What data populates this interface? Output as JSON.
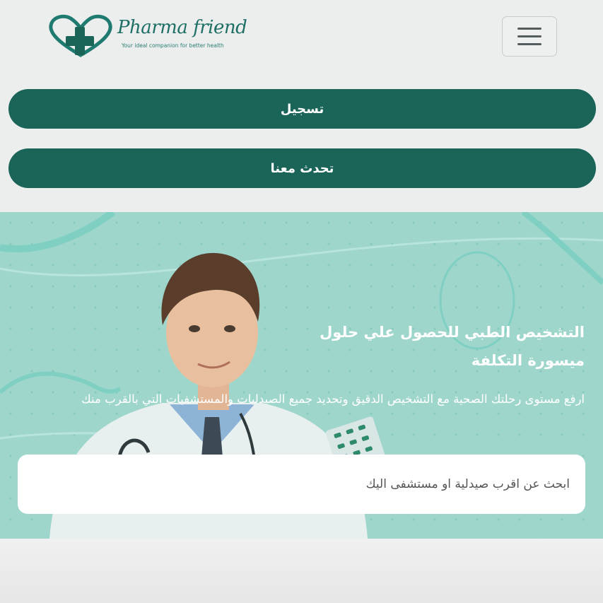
{
  "header": {
    "logo_name": "Pharma friend",
    "logo_tagline": "Your ideal companion for better health",
    "menu_icon": "hamburger-menu-icon"
  },
  "actions": {
    "register_label": "تسجيل",
    "chat_label": "تحدث معنا"
  },
  "hero": {
    "title": "التشخيص الطبي للحصول علي حلول ميسورة التكلفة",
    "subtitle": "ارفع مستوى رحلتك الصحية مع التشخيص الدقيق وتحديد جميع الصيدليات والمستشفيات التي بالقرب منك",
    "search_placeholder": "ابحث عن اقرب صيدلية او مستشفى اليك"
  },
  "colors": {
    "brand": "#1a6458",
    "hero_bg": "#9fd6cc",
    "page_bg": "#eceeee"
  }
}
